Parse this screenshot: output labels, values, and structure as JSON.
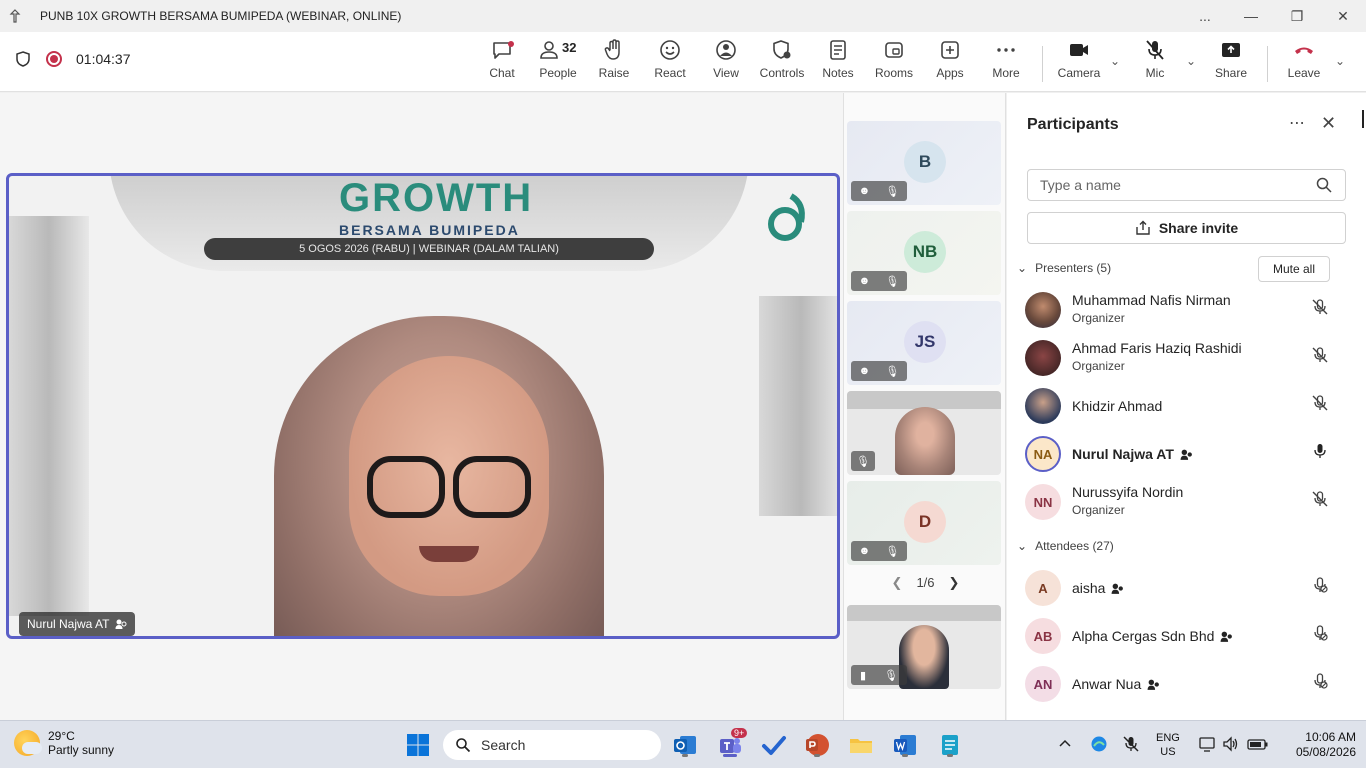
{
  "window": {
    "title": "PUNB 10X GROWTH BERSAMA BUMIPEDA (WEBINAR, ONLINE)",
    "controls": [
      "...",
      "—",
      "❐",
      "✕"
    ]
  },
  "meeting": {
    "timer": "01:04:37",
    "toolbar": {
      "chat": "Chat",
      "people": "People",
      "people_count": "32",
      "raise": "Raise",
      "react": "React",
      "view": "View",
      "controls": "Controls",
      "notes": "Notes",
      "rooms": "Rooms",
      "apps": "Apps",
      "more": "More",
      "camera": "Camera",
      "mic": "Mic",
      "share": "Share",
      "leave": "Leave"
    },
    "main_speaker": "Nurul Najwa AT",
    "banner": {
      "line1": "GROWTH",
      "line2": "BERSAMA BUMIPEDA",
      "line3": "5 OGOS 2026 (RABU) | WEBINAR (DALAM TALIAN)"
    }
  },
  "gallery": {
    "tiles": [
      {
        "initials": "B",
        "bg": "#d6e4ee",
        "fg": "#2f4a5c"
      },
      {
        "initials": "NB",
        "bg": "#cdebd9",
        "fg": "#1f5e3b"
      },
      {
        "initials": "JS",
        "bg": "#dfe0f2",
        "fg": "#33376b"
      },
      {
        "initials": "",
        "bg": "",
        "fg": ""
      },
      {
        "initials": "D",
        "bg": "#f5d9d2",
        "fg": "#7a3326"
      }
    ],
    "pager": "1/6"
  },
  "participants": {
    "title": "Participants",
    "search_placeholder": "Type a name",
    "share_invite": "Share invite",
    "presenters_label": "Presenters (5)",
    "mute_all": "Mute all",
    "attendees_label": "Attendees (27)",
    "presenters": [
      {
        "name": "Muhammad Nafis Nirman",
        "role": "Organizer",
        "initials": "",
        "photo": true
      },
      {
        "name": "Ahmad Faris Haziq Rashidi",
        "role": "Organizer",
        "initials": "",
        "photo": true
      },
      {
        "name": "Khidzir Ahmad",
        "role": "",
        "initials": "",
        "photo": true
      },
      {
        "name": "Nurul Najwa AT",
        "role": "",
        "initials": "NA",
        "photo": false
      },
      {
        "name": "Nurussyifa Nordin",
        "role": "Organizer",
        "initials": "NN",
        "photo": false
      }
    ],
    "attendees": [
      {
        "name": "aisha",
        "initials": "A"
      },
      {
        "name": "Alpha Cergas Sdn Bhd",
        "initials": "AB"
      },
      {
        "name": "Anwar Nua",
        "initials": "AN"
      }
    ]
  },
  "taskbar": {
    "temperature": "29°C",
    "weather": "Partly sunny",
    "search": "Search",
    "teams_badge": "9+",
    "lang": "ENG",
    "region": "US",
    "time": "10:06 AM",
    "date": "05/08/2026"
  },
  "colors": {
    "accent": "#5b5fc7",
    "leave_red": "#c4314b"
  }
}
